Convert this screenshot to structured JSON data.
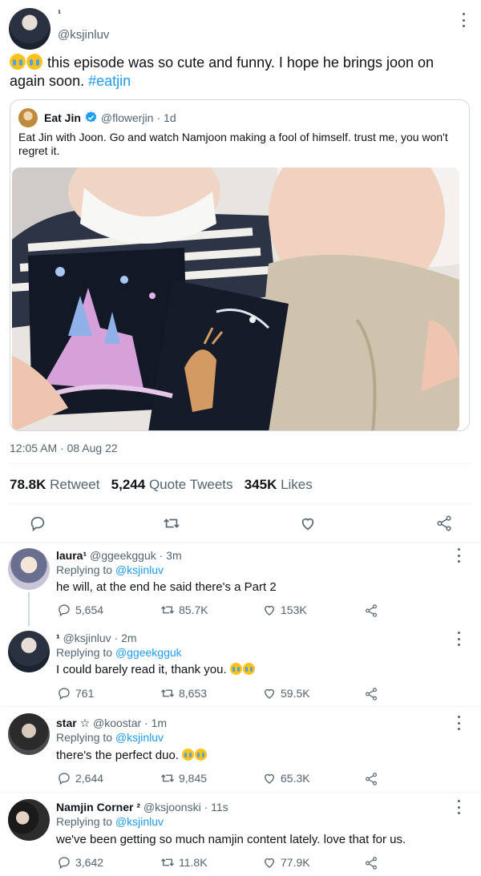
{
  "main_tweet": {
    "display_name": "¹",
    "handle": "@ksjinluv",
    "text": "this episode was so cute and funny. I hope he brings joon on again soon.",
    "hashtag": "#eatjin",
    "timestamp": "12:05 AM · 08 Aug 22"
  },
  "quoted_tweet": {
    "display_name": "Eat Jin",
    "handle": "@flowerjin",
    "time": "· 1d",
    "text": "Eat Jin with Joon. Go and watch Namjoon making a fool of himself. trust me, you won't regret it."
  },
  "stats": {
    "retweets": "78.8K",
    "retweets_label": "Retweet",
    "quotes": "5,244",
    "quotes_label": "Quote Tweets",
    "likes": "345K",
    "likes_label": "Likes"
  },
  "replies": [
    {
      "display_name": "laura¹",
      "handle": "@ggeekgguk",
      "time": "· 3m",
      "replying_label": "Replying to",
      "replying_to": "@ksjinluv",
      "text": "he will, at the end he said there's a Part 2",
      "reply_count": "5,654",
      "retweet_count": "85.7K",
      "like_count": "153K"
    },
    {
      "display_name": "¹",
      "handle": "@ksjinluv",
      "time": "· 2m",
      "replying_label": "Replying to",
      "replying_to": "@ggeekgguk",
      "text": "I could barely read it, thank you.",
      "reply_count": "761",
      "retweet_count": "8,653",
      "like_count": "59.5K"
    },
    {
      "display_name": "star ☆",
      "handle": "@koostar",
      "time": "· 1m",
      "replying_label": "Replying to",
      "replying_to": "@ksjinluv",
      "text": "there's the perfect duo.",
      "reply_count": "2,644",
      "retweet_count": "9,845",
      "like_count": "65.3K"
    },
    {
      "display_name": "Namjin Corner ²",
      "handle": "@ksjoonski",
      "time": "· 11s",
      "replying_label": "Replying to",
      "replying_to": "@ksjinluv",
      "text": "we've been getting so much namjin content lately. love that for us.",
      "reply_count": "3,642",
      "retweet_count": "11.8K",
      "like_count": "77.9K"
    }
  ],
  "colors": {
    "accent": "#1d9bf0",
    "text": "#0f1419",
    "muted": "#536471",
    "divider": "#eff3f4"
  }
}
